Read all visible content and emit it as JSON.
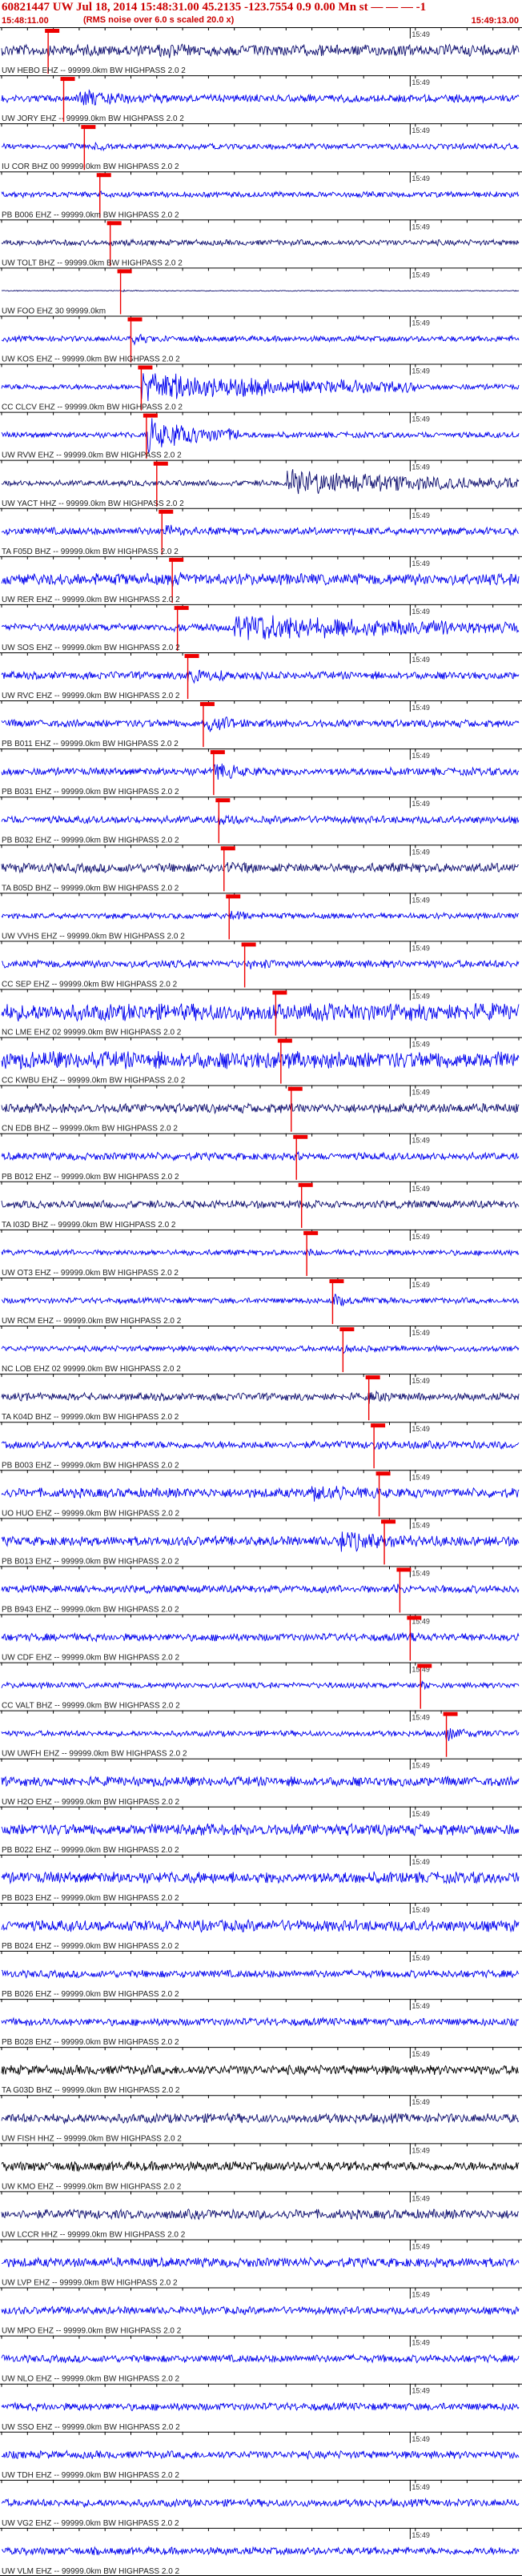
{
  "header": {
    "title": "60821447 UW Jul 18, 2014 15:48:31.00   45.2135 -123.7554  0.9 0.00 Mn st — — — -1",
    "subline": "(RMS noise over 6.0 s scaled 20.0 x)",
    "time_start": "15:48:11.00",
    "time_end": "15:49:13.00"
  },
  "chart_data": {
    "type": "line",
    "title": "60821447 UW Jul 18, 2014 15:48:31.00   45.2135 -123.7554  0.9 0.00 Mn st — — — -1",
    "x_range": [
      "15:48:11.00",
      "15:49:13.00"
    ],
    "tick_label": "15:49",
    "grid": false,
    "colors": {
      "blue": "#0000ee",
      "navy": "#101070",
      "black": "#000000",
      "pick": "#ee0000"
    },
    "traces": [
      {
        "label": "UW HEBO EHZ -- 99999.0km BW  HIGHPASS  2.0  2",
        "color": "navy",
        "amp": 0.6,
        "pick": 0.09,
        "burst": [
          0.3,
          0.5,
          1.0
        ]
      },
      {
        "label": "UW JORY EHZ -- 99999.0km BW  HIGHPASS  2.0  2",
        "color": "blue",
        "amp": 0.4,
        "pick": 0.12,
        "burst": [
          0.15,
          0.35,
          1.2
        ]
      },
      {
        "label": "IU COR BHZ 00 99999.0km BW  HIGHPASS  2.0  2",
        "color": "blue",
        "amp": 0.3,
        "pick": 0.16,
        "burst": [
          0.18,
          0.25,
          0.6
        ]
      },
      {
        "label": "PB B006 EHZ -- 99999.0km BW  HIGHPASS  2.0  2",
        "color": "blue",
        "amp": 0.3,
        "pick": 0.19,
        "burst": [
          0.19,
          0.25,
          0.5
        ]
      },
      {
        "label": "UW TOLT BHZ -- 99999.0km BW  HIGHPASS  2.0  2",
        "color": "navy",
        "amp": 0.3,
        "pick": 0.21,
        "burst": [
          0.21,
          0.28,
          0.5
        ]
      },
      {
        "label": "UW FOO EHZ 30 99999.0km",
        "color": "navy",
        "amp": 0.05,
        "pick": 0.23,
        "burst": [
          0.23,
          0.26,
          0.2
        ]
      },
      {
        "label": "UW KOS EHZ -- 99999.0km BW  HIGHPASS  2.0  2",
        "color": "blue",
        "amp": 0.3,
        "pick": 0.25,
        "burst": [
          0.25,
          0.32,
          0.8
        ]
      },
      {
        "label": "CC CLCV EHZ -- 99999.0km BW  HIGHPASS  2.0  2",
        "color": "blue",
        "amp": 0.3,
        "pick": 0.27,
        "burst": [
          0.27,
          0.8,
          1.8
        ]
      },
      {
        "label": "UW RVW EHZ -- 99999.0km BW  HIGHPASS  2.0  2",
        "color": "blue",
        "amp": 0.3,
        "pick": 0.28,
        "burst": [
          0.28,
          0.46,
          2.0
        ]
      },
      {
        "label": "UW YACT HHZ -- 99999.0km BW  HIGHPASS  2.0  2",
        "color": "navy",
        "amp": 0.3,
        "pick": 0.3,
        "burst": [
          0.55,
          1.0,
          1.6
        ]
      },
      {
        "label": "TA F05D BHZ -- 99999.0km BW  HIGHPASS  2.0  2",
        "color": "blue",
        "amp": 0.4,
        "pick": 0.31,
        "burst": [
          0.31,
          0.4,
          0.9
        ]
      },
      {
        "label": "UW RER EHZ -- 99999.0km BW  HIGHPASS  2.0  2",
        "color": "blue",
        "amp": 0.6,
        "pick": 0.33,
        "burst": [
          0.33,
          0.45,
          0.9
        ]
      },
      {
        "label": "UW SOS EHZ -- 99999.0km BW  HIGHPASS  2.0  2",
        "color": "blue",
        "amp": 0.4,
        "pick": 0.34,
        "burst": [
          0.45,
          1.0,
          1.8
        ]
      },
      {
        "label": "UW RVC EHZ -- 99999.0km BW  HIGHPASS  2.0  2",
        "color": "blue",
        "amp": 0.4,
        "pick": 0.36,
        "burst": [
          0.36,
          0.55,
          0.9
        ]
      },
      {
        "label": "PB B011 EHZ -- 99999.0km BW  HIGHPASS  2.0  2",
        "color": "blue",
        "amp": 0.4,
        "pick": 0.39,
        "burst": [
          0.4,
          0.55,
          1.0
        ]
      },
      {
        "label": "PB B031 EHZ -- 99999.0km BW  HIGHPASS  2.0  2",
        "color": "blue",
        "amp": 0.4,
        "pick": 0.41,
        "burst": [
          0.41,
          0.52,
          1.2
        ]
      },
      {
        "label": "PB B032 EHZ -- 99999.0km BW  HIGHPASS  2.0  2",
        "color": "blue",
        "amp": 0.4,
        "pick": 0.42,
        "burst": [
          0.42,
          0.5,
          0.9
        ]
      },
      {
        "label": "TA B05D BHZ -- 99999.0km BW  HIGHPASS  2.0  2",
        "color": "navy",
        "amp": 0.5,
        "pick": 0.43,
        "burst": [
          0.43,
          0.6,
          0.8
        ]
      },
      {
        "label": "UW VVHS EHZ -- 99999.0km BW  HIGHPASS  2.0  2",
        "color": "blue",
        "amp": 0.3,
        "pick": 0.44,
        "burst": [
          0.44,
          0.5,
          0.9
        ]
      },
      {
        "label": "CC SEP EHZ -- 99999.0km BW  HIGHPASS  2.0  2",
        "color": "blue",
        "amp": 0.4,
        "pick": 0.47,
        "burst": [
          0.48,
          0.6,
          0.7
        ]
      },
      {
        "label": "NC LME EHZ 02 99999.0km BW  HIGHPASS  2.0  2",
        "color": "blue",
        "amp": 0.9,
        "pick": 0.53,
        "burst": [
          0.53,
          0.75,
          1.0
        ]
      },
      {
        "label": "CC KWBU EHZ -- 99999.0km BW  HIGHPASS  2.0  2",
        "color": "blue",
        "amp": 0.9,
        "pick": 0.54,
        "burst": [
          0.5,
          0.65,
          1.2
        ]
      },
      {
        "label": "CN EDB BHZ -- 99999.0km BW  HIGHPASS  2.0  2",
        "color": "navy",
        "amp": 0.5,
        "pick": 0.56,
        "burst": [
          0.56,
          0.6,
          0.5
        ]
      },
      {
        "label": "PB B012 EHZ -- 99999.0km BW  HIGHPASS  2.0  2",
        "color": "blue",
        "amp": 0.4,
        "pick": 0.57,
        "burst": [
          0.57,
          0.62,
          0.6
        ]
      },
      {
        "label": "TA I03D BHZ -- 99999.0km BW  HIGHPASS  2.0  2",
        "color": "navy",
        "amp": 0.4,
        "pick": 0.58,
        "burst": [
          0.58,
          0.64,
          0.6
        ]
      },
      {
        "label": "UW OT3 EHZ -- 99999.0km BW  HIGHPASS  2.0  2",
        "color": "blue",
        "amp": 0.3,
        "pick": 0.59,
        "burst": [
          0.59,
          0.64,
          0.6
        ]
      },
      {
        "label": "UW RCM EHZ -- 99999.0km BW  HIGHPASS  2.0  2",
        "color": "blue",
        "amp": 0.3,
        "pick": 0.64,
        "burst": [
          0.64,
          0.75,
          0.8
        ]
      },
      {
        "label": "NC LOB EHZ 02 99999.0km BW  HIGHPASS  2.0  2",
        "color": "blue",
        "amp": 0.3,
        "pick": 0.66,
        "burst": [
          0.66,
          0.75,
          0.7
        ]
      },
      {
        "label": "TA K04D BHZ -- 99999.0km BW  HIGHPASS  2.0  2",
        "color": "navy",
        "amp": 0.4,
        "pick": 0.71,
        "burst": [
          0.71,
          0.8,
          0.8
        ]
      },
      {
        "label": "PB B003 EHZ -- 99999.0km BW  HIGHPASS  2.0  2",
        "color": "blue",
        "amp": 0.4,
        "pick": 0.72,
        "burst": [
          0.72,
          0.82,
          0.7
        ]
      },
      {
        "label": "UO HUO EHZ -- 99999.0km BW  HIGHPASS  2.0  2",
        "color": "blue",
        "amp": 0.5,
        "pick": 0.73,
        "burst": [
          0.6,
          0.9,
          1.0
        ]
      },
      {
        "label": "PB B013 EHZ -- 99999.0km BW  HIGHPASS  2.0  2",
        "color": "blue",
        "amp": 0.5,
        "pick": 0.74,
        "burst": [
          0.65,
          0.95,
          1.2
        ]
      },
      {
        "label": "PB B943 EHZ -- 99999.0km BW  HIGHPASS  2.0  2",
        "color": "blue",
        "amp": 0.4,
        "pick": 0.77,
        "burst": [
          0.75,
          0.85,
          0.8
        ]
      },
      {
        "label": "UW CDF EHZ -- 99999.0km BW  HIGHPASS  2.0  2",
        "color": "blue",
        "amp": 0.4,
        "pick": 0.79,
        "burst": [
          0.79,
          0.84,
          0.6
        ]
      },
      {
        "label": "CC VALT BHZ -- 99999.0km BW  HIGHPASS  2.0  2",
        "color": "blue",
        "amp": 0.3,
        "pick": 0.81,
        "burst": [
          0.81,
          0.86,
          0.7
        ]
      },
      {
        "label": "UW UWFH EHZ -- 99999.0km BW  HIGHPASS  2.0  2",
        "color": "blue",
        "amp": 0.3,
        "pick": 0.86,
        "burst": [
          0.86,
          0.95,
          1.0
        ]
      },
      {
        "label": "UW H2O EHZ -- 99999.0km BW  HIGHPASS  2.0  2",
        "color": "blue",
        "amp": 0.5,
        "pick": null,
        "burst": null
      },
      {
        "label": "PB B022 EHZ -- 99999.0km BW  HIGHPASS  2.0  2",
        "color": "blue",
        "amp": 0.6,
        "pick": null,
        "burst": null
      },
      {
        "label": "PB B023 EHZ -- 99999.0km BW  HIGHPASS  2.0  2",
        "color": "blue",
        "amp": 0.6,
        "pick": null,
        "burst": null
      },
      {
        "label": "PB B024 EHZ -- 99999.0km BW  HIGHPASS  2.0  2",
        "color": "blue",
        "amp": 0.6,
        "pick": null,
        "burst": [
          0.2,
          0.32,
          0.5
        ]
      },
      {
        "label": "PB B026 EHZ -- 99999.0km BW  HIGHPASS  2.0  2",
        "color": "blue",
        "amp": 0.4,
        "pick": null,
        "burst": null
      },
      {
        "label": "PB B028 EHZ -- 99999.0km BW  HIGHPASS  2.0  2",
        "color": "blue",
        "amp": 0.4,
        "pick": null,
        "burst": [
          0.05,
          0.12,
          0.4
        ]
      },
      {
        "label": "TA G03D BHZ -- 99999.0km BW  HIGHPASS  2.0  2",
        "color": "black",
        "amp": 0.5,
        "pick": null,
        "burst": null
      },
      {
        "label": "UW FISH HHZ -- 99999.0km BW  HIGHPASS  2.0  2",
        "color": "navy",
        "amp": 0.5,
        "pick": null,
        "burst": null
      },
      {
        "label": "UW KMO EHZ -- 99999.0km BW  HIGHPASS  2.0  2",
        "color": "black",
        "amp": 0.5,
        "pick": null,
        "burst": null
      },
      {
        "label": "UW LCCR HHZ -- 99999.0km BW  HIGHPASS  2.0  2",
        "color": "navy",
        "amp": 0.5,
        "pick": null,
        "burst": null
      },
      {
        "label": "UW LVP EHZ -- 99999.0km BW  HIGHPASS  2.0  2",
        "color": "blue",
        "amp": 0.5,
        "pick": null,
        "burst": null
      },
      {
        "label": "UW MPO EHZ -- 99999.0km BW  HIGHPASS  2.0  2",
        "color": "blue",
        "amp": 0.4,
        "pick": null,
        "burst": null
      },
      {
        "label": "UW NLO EHZ -- 99999.0km BW  HIGHPASS  2.0  2",
        "color": "blue",
        "amp": 0.4,
        "pick": null,
        "burst": null
      },
      {
        "label": "UW SSO EHZ -- 99999.0km BW  HIGHPASS  2.0  2",
        "color": "blue",
        "amp": 0.4,
        "pick": null,
        "burst": null
      },
      {
        "label": "UW TDH EHZ -- 99999.0km BW  HIGHPASS  2.0  2",
        "color": "blue",
        "amp": 0.4,
        "pick": null,
        "burst": null
      },
      {
        "label": "UW VG2 EHZ -- 99999.0km BW  HIGHPASS  2.0  2",
        "color": "blue",
        "amp": 0.4,
        "pick": null,
        "burst": null
      },
      {
        "label": "UW VLM EHZ -- 99999.0km BW  HIGHPASS  2.0  2",
        "color": "blue",
        "amp": 0.4,
        "pick": null,
        "burst": null
      }
    ]
  }
}
